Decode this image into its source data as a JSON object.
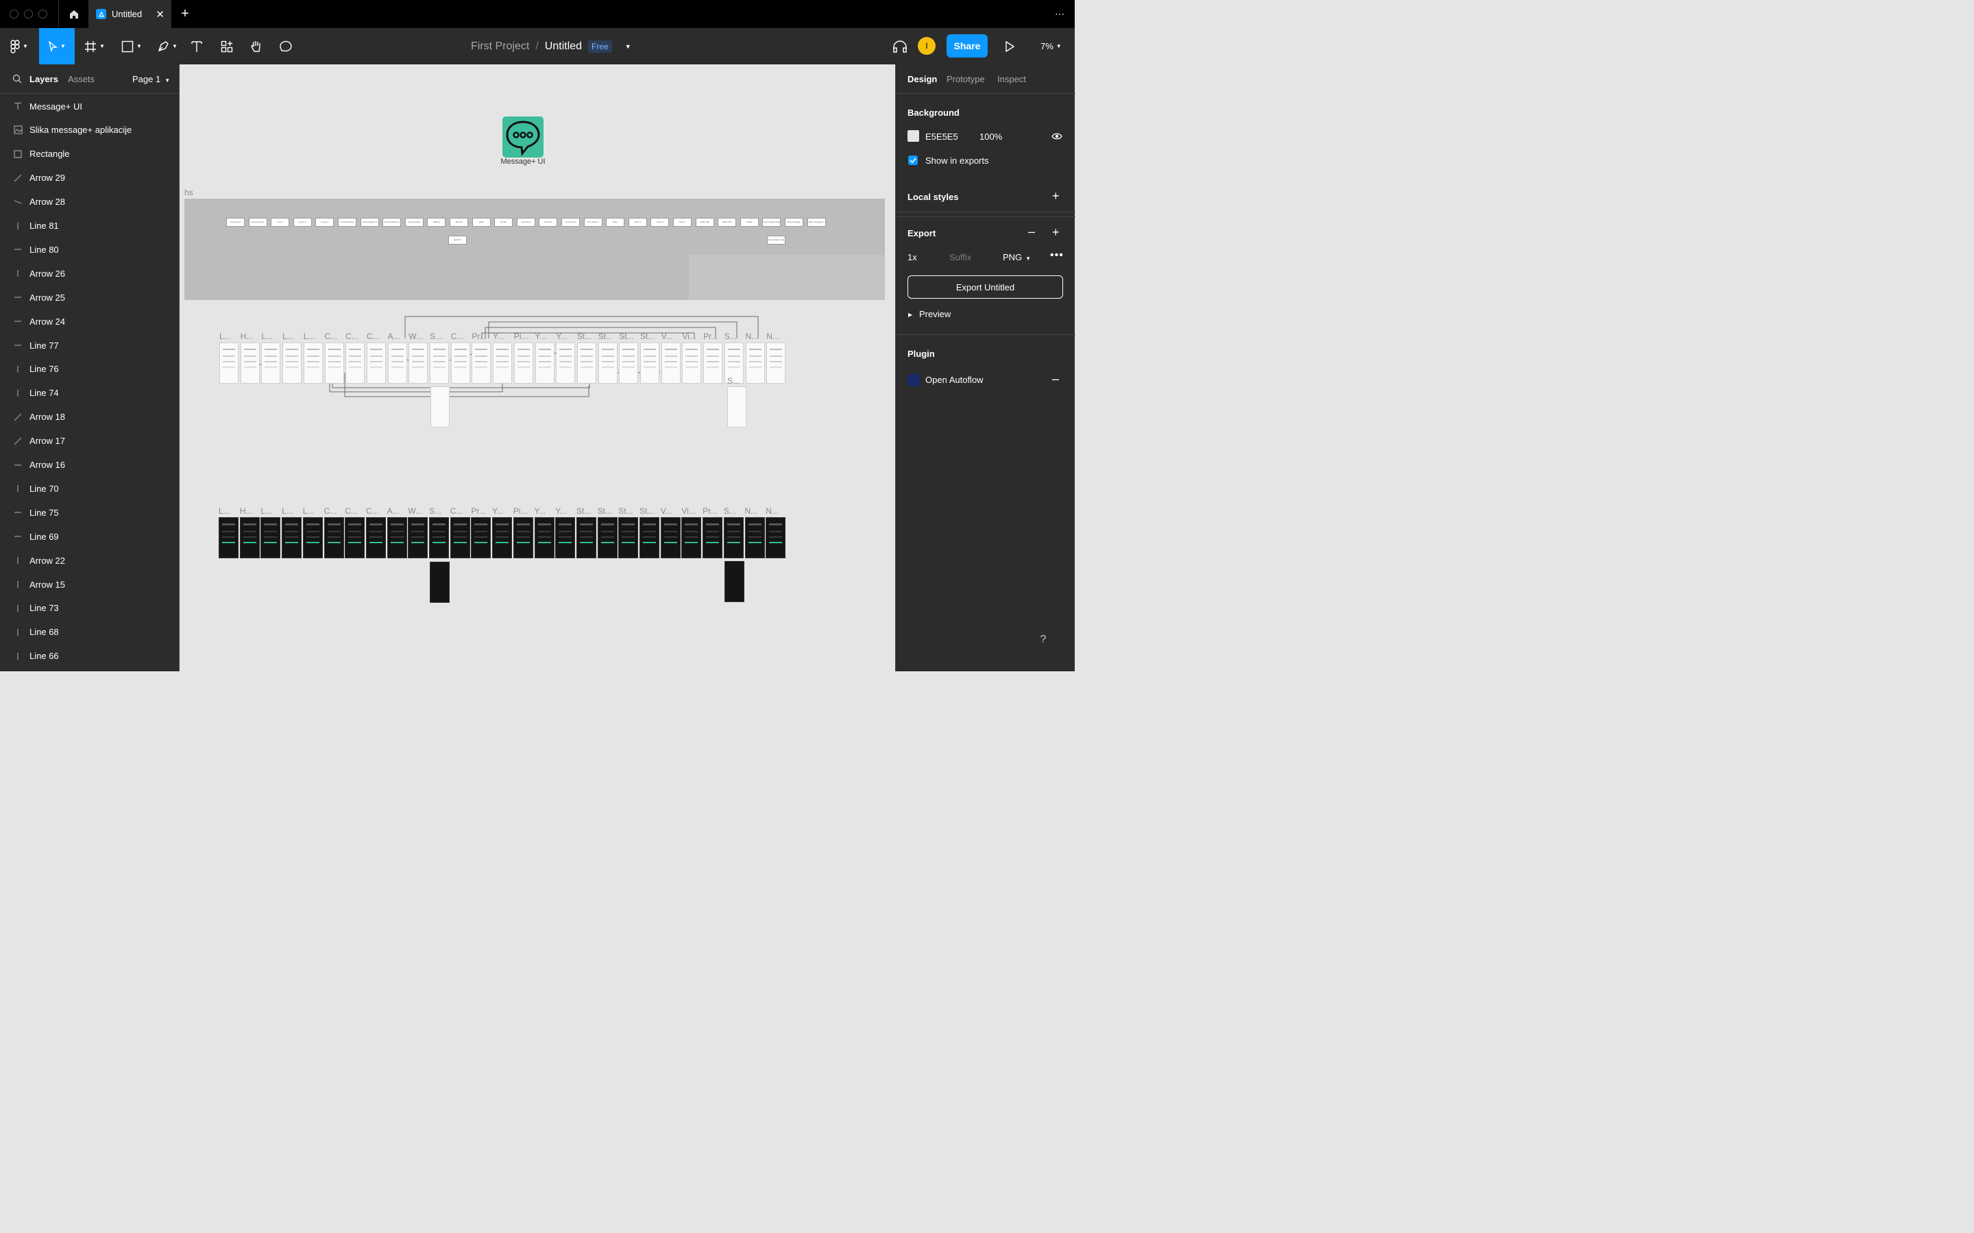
{
  "titlebar": {
    "tab_title": "Untitled",
    "tab_close": "✕",
    "new_tab": "+",
    "more": "⋯"
  },
  "toolbar": {
    "project": "First Project",
    "separator": "/",
    "file": "Untitled",
    "plan_badge": "Free",
    "share": "Share",
    "avatar_initial": "I",
    "zoom": "7%"
  },
  "left_panel": {
    "tabs": [
      "Layers",
      "Assets"
    ],
    "page": "Page 1",
    "layers": [
      {
        "name": "Message+ UI",
        "icon": "text-icon"
      },
      {
        "name": "Slika message+ aplikacije",
        "icon": "image-icon"
      },
      {
        "name": "Rectangle",
        "icon": "rectangle-icon"
      },
      {
        "name": "Arrow 29",
        "icon": "diagonal-line-icon"
      },
      {
        "name": "Arrow 28",
        "icon": "slight-line-icon"
      },
      {
        "name": "Line 81",
        "icon": "vertical-line-icon"
      },
      {
        "name": "Line 80",
        "icon": "horizontal-line-icon"
      },
      {
        "name": "Arrow 26",
        "icon": "vertical-line-icon"
      },
      {
        "name": "Arrow 25",
        "icon": "horizontal-line-icon"
      },
      {
        "name": "Arrow 24",
        "icon": "horizontal-line-icon"
      },
      {
        "name": "Line 77",
        "icon": "horizontal-line-icon"
      },
      {
        "name": "Line 76",
        "icon": "vertical-line-icon"
      },
      {
        "name": "Line 74",
        "icon": "vertical-line-icon"
      },
      {
        "name": "Arrow 18",
        "icon": "diagonal-line-icon"
      },
      {
        "name": "Arrow 17",
        "icon": "diagonal-line-icon"
      },
      {
        "name": "Arrow 16",
        "icon": "horizontal-line-icon"
      },
      {
        "name": "Line 70",
        "icon": "vertical-line-icon"
      },
      {
        "name": "Line 75",
        "icon": "horizontal-line-icon"
      },
      {
        "name": "Line 69",
        "icon": "horizontal-line-icon"
      },
      {
        "name": "Arrow 22",
        "icon": "vertical-line-icon"
      },
      {
        "name": "Arrow 15",
        "icon": "vertical-line-icon"
      },
      {
        "name": "Line 73",
        "icon": "vertical-line-icon"
      },
      {
        "name": "Line 68",
        "icon": "vertical-line-icon"
      },
      {
        "name": "Line 66",
        "icon": "vertical-line-icon"
      }
    ]
  },
  "right_panel": {
    "tabs": [
      "Design",
      "Prototype",
      "Inspect"
    ],
    "background": {
      "title": "Background",
      "hex": "E5E5E5",
      "opacity": "100%",
      "show_in_exports": "Show in exports",
      "swatch_color": "#E5E5E5"
    },
    "local_styles": "Local styles",
    "export": {
      "title": "Export",
      "scale": "1x",
      "suffix_placeholder": "Suffix",
      "format": "PNG",
      "button": "Export Untitled",
      "preview": "Preview"
    },
    "plugin": {
      "title": "Plugin",
      "name": "Open Autoflow"
    }
  },
  "canvas": {
    "logo_label": "Message+ UI",
    "sitemap_frame_label": "hs",
    "sitemap_boxes": [
      "Lock screen",
      "Home screen",
      "Log in",
      "Log in 2",
      "Log in 3",
      "Conversations",
      "Conversations 2",
      "Conversations 3",
      "Active people",
      "Waiting",
      "Sign IN",
      "Chat",
      "Profile",
      "Your Story",
      "Pictures",
      "Your Story 2",
      "Your Story 3",
      "Story",
      "Story 2",
      "Story 3",
      "Story 4",
      "Voice Call",
      "Video Call",
      "Profile",
      "Set up dark mode",
      "New message",
      "New message 2"
    ],
    "sitemap_sub_boxes": [
      "Sat IN 2",
      "Set up light mode"
    ],
    "frame_labels_row1": [
      "L...",
      "H...",
      "L...",
      "L...",
      "L...",
      "C...",
      "C...",
      "C...",
      "A...",
      "W...",
      "S...",
      "C...",
      "Pr...",
      "Y...",
      "Pi...",
      "Y...",
      "Y...",
      "St...",
      "St...",
      "St...",
      "St...",
      "V...",
      "Vi...",
      "Pr...",
      "S...",
      "N...",
      "N..."
    ],
    "frame_labels_row2": [
      "L...",
      "H...",
      "L...",
      "L...",
      "L...",
      "C...",
      "C...",
      "C...",
      "A...",
      "W...",
      "S...",
      "C...",
      "Pr...",
      "Y...",
      "Pi...",
      "Y...",
      "Y...",
      "St...",
      "St...",
      "St...",
      "St...",
      "V...",
      "Vi...",
      "Pr...",
      "S...",
      "N...",
      "N..."
    ],
    "extra_label": "S..."
  },
  "help": "?"
}
